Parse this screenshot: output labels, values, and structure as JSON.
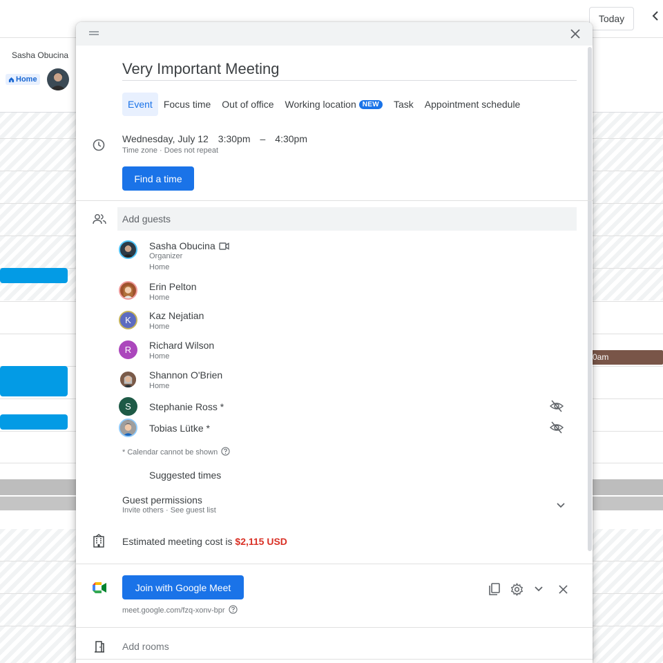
{
  "background": {
    "today_label": "Today",
    "user_name": "Sasha Obucina",
    "home_chip": "Home",
    "event_time": "0am"
  },
  "dialog": {
    "title": "Very Important Meeting",
    "tabs": [
      {
        "label": "Event",
        "active": true
      },
      {
        "label": "Focus time"
      },
      {
        "label": "Out of office"
      },
      {
        "label": "Working location",
        "badge": "NEW"
      },
      {
        "label": "Task"
      },
      {
        "label": "Appointment schedule"
      }
    ],
    "datetime": {
      "date": "Wednesday, July 12",
      "start": "3:30pm",
      "dash": "–",
      "end": "4:30pm",
      "timezone": "Time zone",
      "separator": "·",
      "repeat": "Does not repeat"
    },
    "find_time_label": "Find a time",
    "add_guests_placeholder": "Add guests",
    "guests": [
      {
        "name": "Sasha Obucina",
        "role": "Organizer",
        "location": "Home",
        "initial": "",
        "avatar_color": "#2b3a47"
      },
      {
        "name": "Erin Pelton",
        "location": "Home",
        "initial": "",
        "avatar_color": "#a0522d"
      },
      {
        "name": "Kaz Nejatian",
        "location": "Home",
        "initial": "K",
        "avatar_color": "#5c6bc0"
      },
      {
        "name": "Richard Wilson",
        "location": "Home",
        "initial": "R",
        "avatar_color": "#ab47bc"
      },
      {
        "name": "Shannon O'Brien",
        "location": "Home",
        "initial": "",
        "avatar_color": "#6d4c41"
      },
      {
        "name": "Stephanie Ross *",
        "initial": "S",
        "avatar_color": "#1e5a46"
      },
      {
        "name": "Tobias Lütke *",
        "initial": "",
        "avatar_color": "#8d6e63"
      }
    ],
    "calendar_note": "* Calendar cannot be shown",
    "suggested_times": "Suggested times",
    "guest_permissions": {
      "title": "Guest permissions",
      "invite": "Invite others",
      "separator": "·",
      "see_list": "See guest list"
    },
    "cost": {
      "prefix": "Estimated meeting cost is ",
      "amount": "$2,115 USD"
    },
    "meet": {
      "join_label": "Join with Google Meet",
      "link": "meet.google.com/fzq-xonv-bpr"
    },
    "add_rooms": "Add rooms"
  },
  "colors": {
    "accent": "#1a73e8",
    "cost_red": "#d93025",
    "event_blue": "#039be5",
    "event_brown": "#795548"
  }
}
